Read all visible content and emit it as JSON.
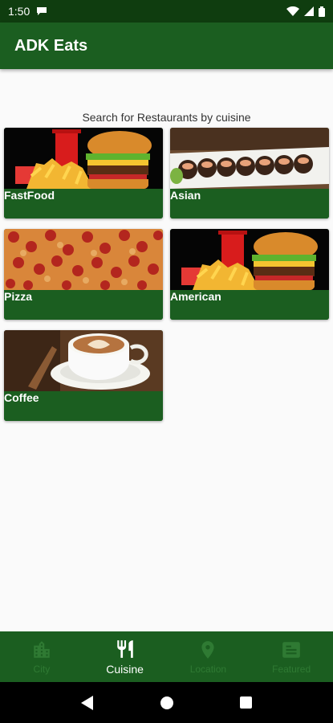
{
  "status_bar": {
    "time": "1:50"
  },
  "app_bar": {
    "title": "ADK Eats"
  },
  "content": {
    "subtitle": "Search for Restaurants by cuisine"
  },
  "cuisines": [
    {
      "label": "FastFood"
    },
    {
      "label": "Asian"
    },
    {
      "label": "Pizza"
    },
    {
      "label": "American"
    },
    {
      "label": "Coffee"
    }
  ],
  "bottom_nav": {
    "items": [
      {
        "label": "City",
        "icon": "city-icon",
        "active": false
      },
      {
        "label": "Cuisine",
        "icon": "utensils-icon",
        "active": true
      },
      {
        "label": "Location",
        "icon": "location-pin-icon",
        "active": false
      },
      {
        "label": "Featured",
        "icon": "featured-icon",
        "active": false
      }
    ]
  },
  "colors": {
    "primary": "#1b5e20",
    "status": "#0f3d0f",
    "background": "#fafafa"
  }
}
